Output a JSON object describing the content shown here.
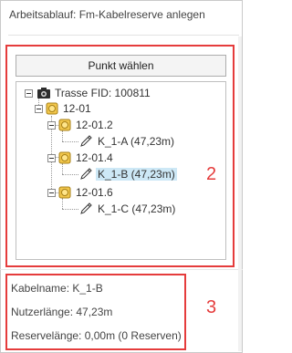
{
  "panel": {
    "title": "Arbeitsablauf: Fm-Kabelreserve anlegen"
  },
  "button": {
    "label": "Punkt wählen"
  },
  "tree": {
    "root": "Trasse FID: 100811",
    "n1": "12-01",
    "n2": "12-01.2",
    "n3": "K_1-A (47,23m)",
    "n4": "12-01.4",
    "n5": "K_1-B (47,23m)",
    "n6": "12-01.6",
    "n7": "K_1-C (47,23m)"
  },
  "annotations": {
    "a2": "2",
    "a3": "3"
  },
  "info": {
    "kabelname": "Kabelname: K_1-B",
    "nutzerlaenge": "Nutzerlänge: 47,23m",
    "reservelaenge": "Reservelänge: 0,00m (0 Reserven)"
  }
}
